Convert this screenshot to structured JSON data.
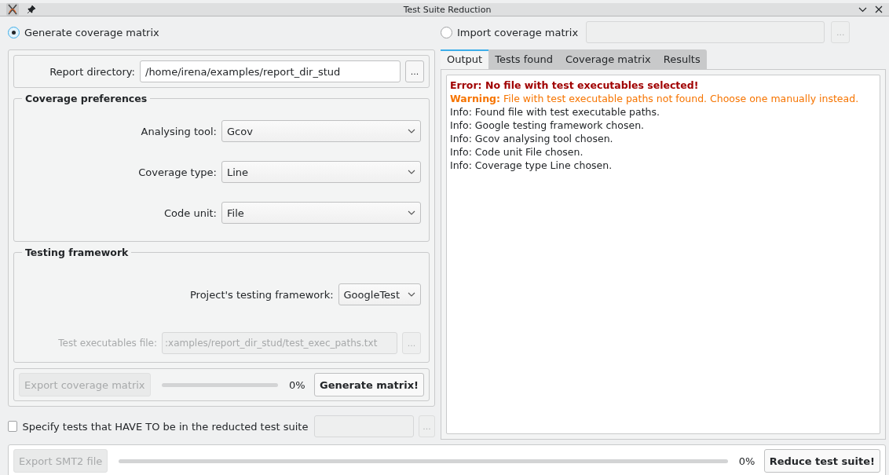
{
  "window": {
    "title": "Test Suite Reduction"
  },
  "mode_options": [
    {
      "label": "Generate coverage matrix",
      "selected": true
    },
    {
      "label": "Import coverage matrix",
      "selected": false
    }
  ],
  "import_field": {
    "disabled": true,
    "browse": "..."
  },
  "report_directory": {
    "label": "Report directory:",
    "value": "/home/irena/examples/report_dir_stud",
    "browse": "..."
  },
  "coverage_preferences": {
    "title": "Coverage preferences",
    "fields": [
      {
        "label": "Analysing tool:",
        "value": "Gcov"
      },
      {
        "label": "Coverage type:",
        "value": "Line"
      },
      {
        "label": "Code unit:",
        "value": "File"
      }
    ]
  },
  "testing_framework": {
    "title": "Testing framework",
    "framework": {
      "label": "Project's testing framework:",
      "value": "GoogleTest"
    },
    "executables_file": {
      "label": "Test executables file:",
      "value": ":xamples/report_dir_stud/test_exec_paths.txt",
      "browse": "...",
      "disabled": true
    }
  },
  "matrix_bar": {
    "export_button": {
      "label": "Export coverage matrix",
      "disabled": true
    },
    "progress": {
      "level": 0,
      "reading": "0%"
    },
    "generate_button": "Generate matrix!"
  },
  "required_tests": {
    "label": "Specify tests that HAVE TO be in the reducted test suite",
    "checked": false,
    "browse": "...",
    "disabled": true
  },
  "tabs": [
    {
      "label": "Output",
      "selected": true
    },
    {
      "label": "Tests found",
      "selected": false
    },
    {
      "label": "Coverage matrix",
      "selected": false
    },
    {
      "label": "Results",
      "selected": false
    }
  ],
  "output_lines": [
    {
      "kind": "error",
      "text": "Error: No file with test executables selected!"
    },
    {
      "kind": "warning",
      "text": "**Warning:** File with test executable paths not found. Choose one manually instead."
    },
    {
      "kind": "info",
      "text": "Info: Found file with test executable paths."
    },
    {
      "kind": "info",
      "text": "Info: Google testing framework chosen."
    },
    {
      "kind": "info",
      "text": "Info: Gcov analysing tool chosen."
    },
    {
      "kind": "info",
      "text": "Info: Code unit File chosen."
    },
    {
      "kind": "info",
      "text": "Info: Coverage type Line chosen."
    }
  ],
  "reduce_bar": {
    "export_button": {
      "label": "Export SMT2 file",
      "disabled": true
    },
    "progress": {
      "level": 0,
      "reading": "0%"
    },
    "reduce_button": "Reduce test suite!"
  }
}
